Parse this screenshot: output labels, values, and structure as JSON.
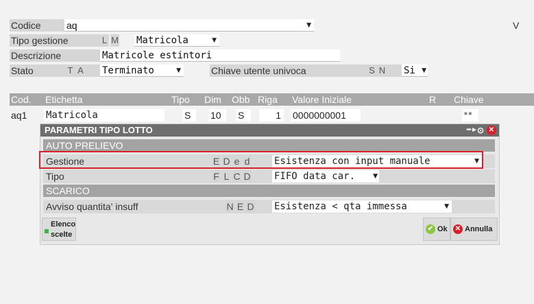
{
  "form": {
    "codice_label": "Codice",
    "codice_value": "aq",
    "corner_letter": "V",
    "tipo_gestione_label": "Tipo gestione",
    "tipo_gestione_keys": [
      "L",
      "M"
    ],
    "tipo_gestione_value": "Matricola",
    "descrizione_label": "Descrizione",
    "descrizione_value": "Matricole estintori",
    "stato_label": "Stato",
    "stato_keys": [
      "T",
      "A"
    ],
    "stato_value": "Terminato",
    "chiave_label": "Chiave utente univoca",
    "chiave_keys": [
      "S",
      "N"
    ],
    "chiave_value": "Si"
  },
  "grid": {
    "headers": [
      "Cod.",
      "Etichetta",
      "Tipo",
      "Dim",
      "Obb",
      "Riga",
      "Valore Iniziale",
      "R",
      "Chiave"
    ],
    "row": {
      "cod": "aq1",
      "etichetta": "Matricola",
      "tipo": "S",
      "dim": "10",
      "obb": "S",
      "riga": "1",
      "valore": "0000000001",
      "chiave": "**"
    }
  },
  "dialog": {
    "title": "PARAMETRI TIPO LOTTO",
    "section_auto": "AUTO PRELIEVO",
    "gestione_label": "Gestione",
    "gestione_keys": [
      "E",
      "D",
      "e",
      "d"
    ],
    "gestione_value": "Esistenza con input manuale",
    "tipo_label": "Tipo",
    "tipo_keys": [
      "F",
      "L",
      "C",
      "D"
    ],
    "tipo_value": "FIFO data car.",
    "section_scarico": "SCARICO",
    "avviso_label": "Avviso quantita' insuff",
    "avviso_keys": [
      "N",
      "E",
      "D"
    ],
    "avviso_value": "Esistenza < qta immessa",
    "elenco_label_1": "Elenco",
    "elenco_label_2": "scelte",
    "ok_label": "Ok",
    "annulla_label": "Annulla"
  },
  "colors": {
    "highlight_border": "#d9202a",
    "ok_icon": "#8cc63f",
    "annulla_icon": "#d9202a"
  }
}
